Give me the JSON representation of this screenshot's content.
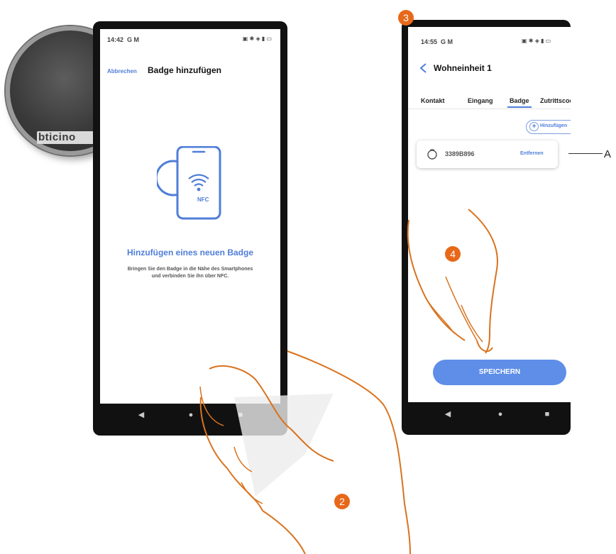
{
  "fob": {
    "brand": "bticino"
  },
  "phone1": {
    "time": "14:42",
    "status_left_icons": "G M",
    "status_right_icons": "▣ ✱ ◈ ▮ ▭",
    "cancel_label": "Abbrechen",
    "title": "Badge hinzufügen",
    "nfc_label": "NFC",
    "heading": "Hinzufügen eines neuen Badge",
    "instruction_line1": "Bringen Sie den Badge in die Nähe des Smartphones",
    "instruction_line2": "und verbinden Sie ihn über NFC."
  },
  "phone2": {
    "time": "14:55",
    "status_left_icons": "G M",
    "status_right_icons": "▣ ✱ ◈ ▮ ▭",
    "title": "Wohneinheit 1",
    "tabs": [
      {
        "label": "Kontakt",
        "active": false
      },
      {
        "label": "Eingang",
        "active": false
      },
      {
        "label": "Badge",
        "active": true
      },
      {
        "label": "Zutrittscode",
        "active": false
      }
    ],
    "add_label": "Hinzufügen",
    "badge_id": "3389B896",
    "remove_label": "Entfernen",
    "save_label": "SPEICHERN"
  },
  "nav": {
    "back": "◀",
    "home": "●",
    "recent": "■"
  },
  "steps": {
    "two": "2",
    "three": "3",
    "four": "4"
  },
  "callout_label": "A",
  "colors": {
    "accent": "#4f7ed8",
    "step": "#e8681a",
    "hand_outline": "#d9731f",
    "save_button": "#5f8ee8"
  }
}
